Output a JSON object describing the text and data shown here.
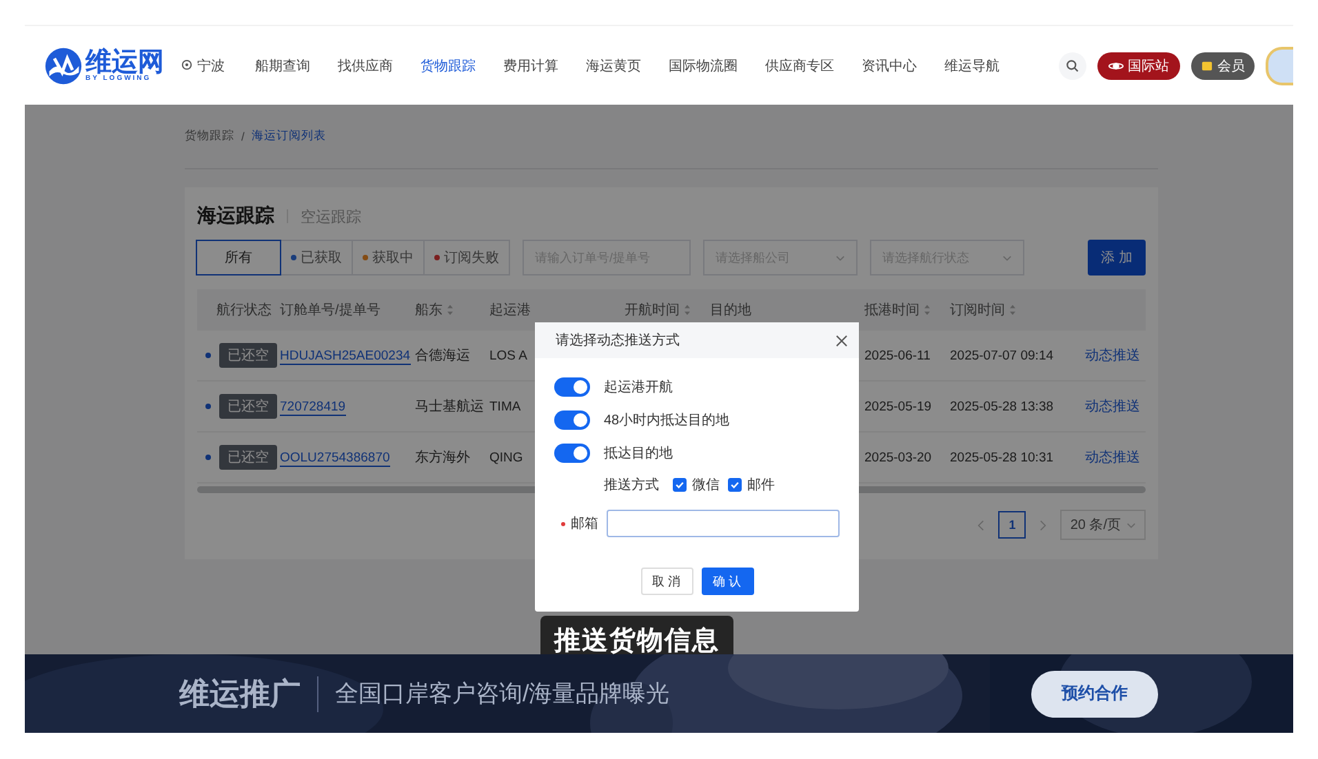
{
  "header": {
    "logo": {
      "name": "维运网",
      "tagline": "BY LOGWING"
    },
    "location": "宁波",
    "nav": [
      {
        "label": "船期查询",
        "selected": false
      },
      {
        "label": "找供应商",
        "selected": false
      },
      {
        "label": "货物跟踪",
        "selected": true
      },
      {
        "label": "费用计算",
        "selected": false
      },
      {
        "label": "海运黄页",
        "selected": false
      },
      {
        "label": "国际物流圈",
        "selected": false
      },
      {
        "label": "供应商专区",
        "selected": false
      },
      {
        "label": "资讯中心",
        "selected": false
      },
      {
        "label": "维运导航",
        "selected": false
      }
    ],
    "region_button": "国际站",
    "member_button": "会员"
  },
  "breadcrumb": {
    "items": [
      {
        "label": "货物跟踪",
        "selected": false
      },
      {
        "label": "海运订阅列表",
        "selected": true
      }
    ],
    "separator": "/"
  },
  "card": {
    "tabs": [
      {
        "label": "海运跟踪",
        "selected": true
      },
      {
        "label": "空运跟踪",
        "selected": false
      }
    ],
    "status_filters": [
      {
        "label": "所有",
        "selected": true
      },
      {
        "label": "已获取",
        "color": "#1a3d7b",
        "selected": false
      },
      {
        "label": "获取中",
        "color": "#844c14",
        "selected": false
      },
      {
        "label": "订阅失败",
        "color": "#7b2020",
        "selected": false
      }
    ],
    "order_field": {
      "placeholder": "请输入订单号/提单号"
    },
    "dropdowns": [
      {
        "placeholder": "请选择船公司"
      },
      {
        "placeholder": "请选择航行状态"
      }
    ],
    "add_button": "添 加",
    "table": {
      "columns": [
        {
          "label": "航行状态",
          "sortable": false
        },
        {
          "label": "订舱单号/提单号",
          "sortable": false
        },
        {
          "label": "船东",
          "sortable": true
        },
        {
          "label": "起运港",
          "sortable": false
        },
        {
          "label": "开航时间",
          "sortable": true
        },
        {
          "label": "目的地",
          "sortable": false
        },
        {
          "label": "抵港时间",
          "sortable": true
        },
        {
          "label": "订阅时间",
          "sortable": true
        }
      ],
      "rows": [
        {
          "status": "已还空",
          "order_no": "HDUJASH25AE00234",
          "carrier": "合德海运",
          "origin": "LOS A",
          "arrival": "2025-06-11",
          "subscribed": "2025-07-07 09:14",
          "action": "动态推送"
        },
        {
          "status": "已还空",
          "order_no": "720728419",
          "carrier": "马士基航运",
          "origin": "TIMA",
          "arrival": "2025-05-19",
          "subscribed": "2025-05-28 13:38",
          "action": "动态推送"
        },
        {
          "status": "已还空",
          "order_no": "OOLU2754386870",
          "carrier": "东方海外",
          "origin": "QING",
          "arrival": "2025-03-20",
          "subscribed": "2025-05-28 10:31",
          "action": "动态推送"
        }
      ]
    },
    "pagination": {
      "pages": [
        {
          "label": "1",
          "selected": true
        }
      ],
      "page_size": "20 条/页"
    }
  },
  "dialog": {
    "title": "请选择动态推送方式",
    "toggles": [
      {
        "label": "起运港开航",
        "on": true
      },
      {
        "label": "48小时内抵达目的地",
        "on": true
      },
      {
        "label": "抵达目的地",
        "on": true
      }
    ],
    "push_label": "推送方式",
    "channels": [
      {
        "label": "微信",
        "checked": true
      },
      {
        "label": "邮件",
        "checked": true
      }
    ],
    "email": {
      "label": "邮箱",
      "required": true
    },
    "cancel_button": "取 消",
    "confirm_button": "确 认"
  },
  "subtitle": "推送货物信息",
  "banner": {
    "title": "维运推广",
    "slogan": "全国口岸客户咨询/海量品牌曝光",
    "button": "预约合作"
  }
}
